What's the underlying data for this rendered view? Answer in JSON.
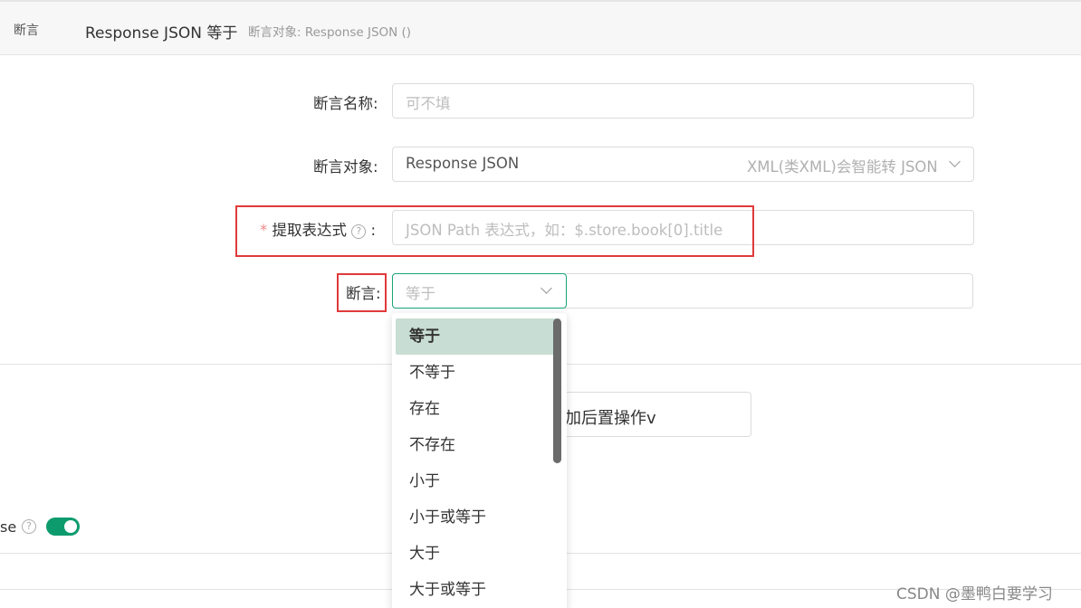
{
  "header": {
    "label": "断言",
    "title": "Response JSON 等于",
    "subtitle": "断言对象: Response JSON ()"
  },
  "form": {
    "name": {
      "label": "断言名称:",
      "placeholder": "可不填"
    },
    "target": {
      "label": "断言对象:",
      "value": "Response JSON",
      "hint": "XML(类XML)会智能转 JSON"
    },
    "expression": {
      "required_mark": "*",
      "label": "提取表达式",
      "help_icon": "?",
      "colon": ":",
      "placeholder": "JSON Path 表达式，如：$.store.book[0].title"
    },
    "assertion": {
      "label": "断言:",
      "placeholder": "等于"
    }
  },
  "dropdown": {
    "options": [
      "等于",
      "不等于",
      "存在",
      "不存在",
      "小于",
      "小于或等于",
      "大于",
      "大于或等于"
    ],
    "selected": "等于"
  },
  "post_action": {
    "label": "加后置操作v"
  },
  "toggle_row": {
    "label_partial": "se",
    "help_icon": "?",
    "enabled": true
  },
  "watermark": "CSDN @墨鸭白要学习",
  "colors": {
    "accent": "#0d9b6e",
    "highlight_box": "#e03a3a",
    "selected_option_bg": "#c8ddd3"
  }
}
